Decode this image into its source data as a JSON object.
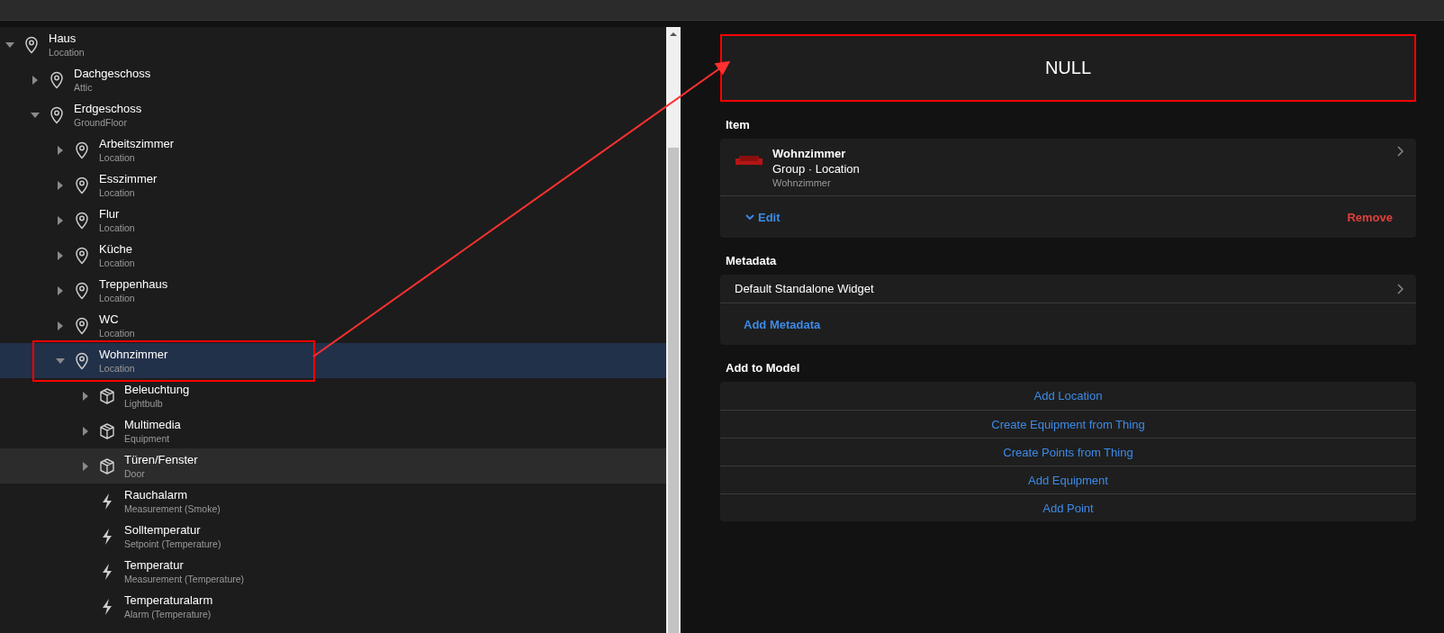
{
  "tree": [
    {
      "label": "Haus",
      "sublabel": "Location",
      "kind": "location",
      "expanded": true,
      "selected": false,
      "hovered": false,
      "children": [
        {
          "label": "Dachgeschoss",
          "sublabel": "Attic",
          "kind": "location",
          "expanded": false,
          "selected": false,
          "hovered": false
        },
        {
          "label": "Erdgeschoss",
          "sublabel": "GroundFloor",
          "kind": "location",
          "expanded": true,
          "selected": false,
          "hovered": false,
          "children": [
            {
              "label": "Arbeitszimmer",
              "sublabel": "Location",
              "kind": "location",
              "expanded": false,
              "selected": false,
              "hovered": false
            },
            {
              "label": "Esszimmer",
              "sublabel": "Location",
              "kind": "location",
              "expanded": false,
              "selected": false,
              "hovered": false
            },
            {
              "label": "Flur",
              "sublabel": "Location",
              "kind": "location",
              "expanded": false,
              "selected": false,
              "hovered": false
            },
            {
              "label": "Küche",
              "sublabel": "Location",
              "kind": "location",
              "expanded": false,
              "selected": false,
              "hovered": false
            },
            {
              "label": "Treppenhaus",
              "sublabel": "Location",
              "kind": "location",
              "expanded": false,
              "selected": false,
              "hovered": false
            },
            {
              "label": "WC",
              "sublabel": "Location",
              "kind": "location",
              "expanded": false,
              "selected": false,
              "hovered": false
            },
            {
              "label": "Wohnzimmer",
              "sublabel": "Location",
              "kind": "location",
              "expanded": true,
              "selected": true,
              "hovered": false,
              "children": [
                {
                  "label": "Beleuchtung",
                  "sublabel": "Lightbulb",
                  "kind": "equipment",
                  "expanded": false,
                  "selected": false,
                  "hovered": false
                },
                {
                  "label": "Multimedia",
                  "sublabel": "Equipment",
                  "kind": "equipment",
                  "expanded": false,
                  "selected": false,
                  "hovered": false
                },
                {
                  "label": "Türen/Fenster",
                  "sublabel": "Door",
                  "kind": "equipment",
                  "expanded": false,
                  "selected": false,
                  "hovered": true
                },
                {
                  "label": "Rauchalarm",
                  "sublabel": "Measurement (Smoke)",
                  "kind": "point",
                  "selected": false,
                  "hovered": false
                },
                {
                  "label": "Solltemperatur",
                  "sublabel": "Setpoint (Temperature)",
                  "kind": "point",
                  "selected": false,
                  "hovered": false
                },
                {
                  "label": "Temperatur",
                  "sublabel": "Measurement (Temperature)",
                  "kind": "point",
                  "selected": false,
                  "hovered": false
                },
                {
                  "label": "Temperaturalarm",
                  "sublabel": "Alarm (Temperature)",
                  "kind": "point",
                  "selected": false,
                  "hovered": false
                }
              ]
            }
          ]
        }
      ]
    }
  ],
  "state_card": {
    "value": "NULL"
  },
  "item_section": {
    "heading": "Item",
    "name": "Wohnzimmer",
    "type": "Group · Location",
    "label": "Wohnzimmer",
    "edit": "Edit",
    "remove": "Remove"
  },
  "metadata_section": {
    "heading": "Metadata",
    "entries": [
      "Default Standalone Widget"
    ],
    "add": "Add Metadata"
  },
  "model_section": {
    "heading": "Add to Model",
    "actions": [
      "Add Location",
      "Create Equipment from Thing",
      "Create Points from Thing",
      "Add Equipment",
      "Add Point"
    ]
  }
}
